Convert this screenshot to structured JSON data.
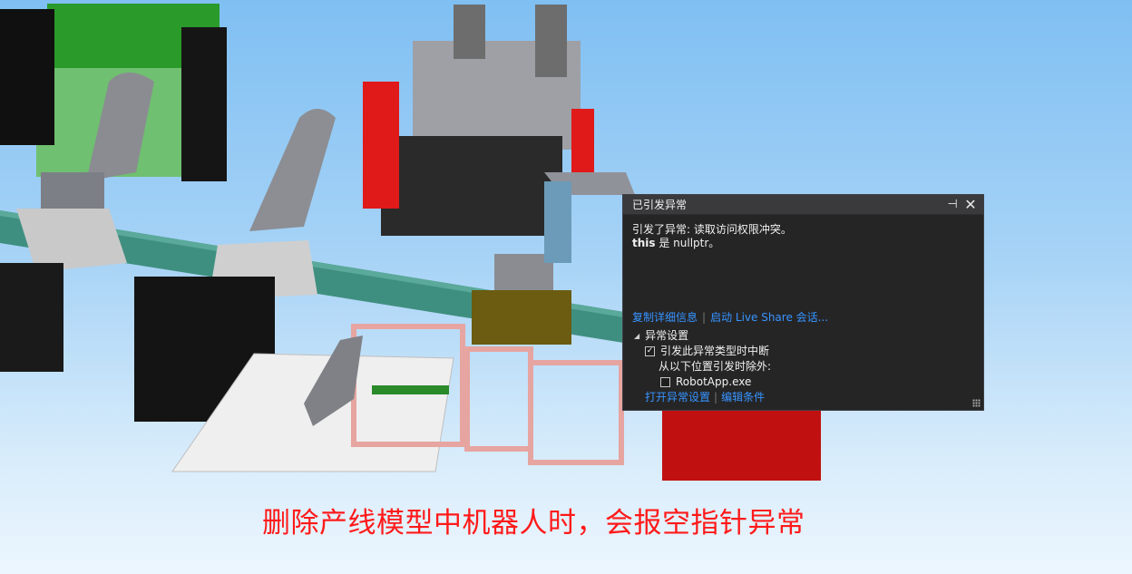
{
  "dialog": {
    "title": "已引发异常",
    "pin_icon": "pin-icon",
    "close_icon": "close-icon",
    "message_line1": "引发了异常: 读取访问权限冲突。",
    "message_this": "this",
    "message_line2_rest": " 是 nullptr。",
    "link_copy": "复制详细信息",
    "link_liveshare": "启动 Live Share 会话...",
    "settings_header": "异常设置",
    "break_label": "引发此异常类型时中断",
    "break_checked": true,
    "except_label": "从以下位置引发时除外:",
    "except_item": "RobotApp.exe",
    "except_item_checked": false,
    "link_open_settings": "打开异常设置",
    "link_edit_conditions": "编辑条件"
  },
  "caption": "删除产线模型中机器人时，会报空指针异常",
  "colors": {
    "background_top": "#7fbff2",
    "dialog_bg": "#252526",
    "link": "#3794ff",
    "caption": "#ff1a1a"
  }
}
